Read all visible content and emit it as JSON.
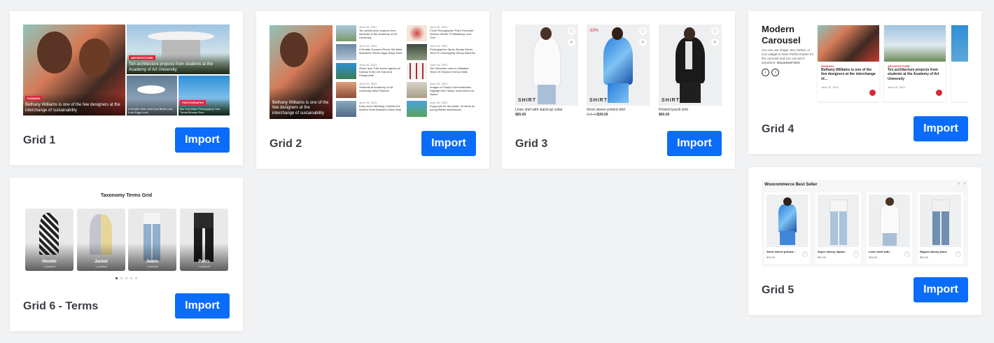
{
  "import_label": "Import",
  "cards": {
    "grid1": {
      "label": "Grid 1",
      "items": [
        {
          "tag": "FASHION",
          "text": "Bethany Williams is one of the few designers at the interchange of sustainability"
        },
        {
          "tag": "ARCHITECTURE",
          "text": "Ten architecture projects from students at the Academy of Art University"
        },
        {
          "tag": "",
          "text": "A Seattle Sets Vivid Fast Birds Lush Lush Eggs Lush"
        },
        {
          "tag": "PHOTOGRAPHY",
          "text": "Bar Trip Make Photography Tent Tourist Bumps Sum"
        }
      ]
    },
    "grid2": {
      "label": "Grid 2",
      "main_text": "Bethany Williams is one of the few designers at the interchange of sustainability",
      "list_left": [
        {
          "date": "June 20, 2021",
          "text": "Ten architecture projects from students at the Academy of Art University"
        },
        {
          "date": "June 20, 2021",
          "text": "A Seattle Gourmet Picnic Set Mind Marketers Stems Eggs Ways More"
        },
        {
          "date": "June 20, 2021",
          "text": "Sheer lace Tulle lovers agents on holiday in the UK that dont Disappoints"
        },
        {
          "date": "June 20, 2021",
          "text": "Students at Academy of Art University Mind Pictures"
        },
        {
          "date": "June 20, 2021",
          "text": "Easy lunch Wedding Catches the World's Most Beautiful Cities Deal"
        }
      ],
      "list_right": [
        {
          "date": "June 20, 2021",
          "text": "Food Photographer Pairs Favourite Women Winter Of Mistaking Look Vine"
        },
        {
          "date": "June 20, 2021",
          "text": "Photographer Spots Steady Winds Tend To Unwrapping Windy Matches"
        },
        {
          "date": "June 20, 2021",
          "text": "Tom Newman uses to inflatable Team Of Olympic Victory Walk"
        },
        {
          "date": "June 20, 2021",
          "text": "Images of Today's Demonstration Highlight the Family Townhomes Art Space"
        },
        {
          "date": "June 20, 2021",
          "text": "A guy pair for the pirate, 16 ideas for young British adventurers"
        }
      ]
    },
    "grid3": {
      "label": "Grid 3",
      "products": [
        {
          "name": "Linen shirt with stand-up collar",
          "price": "$65.00",
          "old_price": "",
          "badge": "",
          "overlay": "SHIRT"
        },
        {
          "name": "Short sleeve printed shirt",
          "price": "$30.00",
          "old_price": "$45.00",
          "badge": "-33%",
          "overlay": "SHIRT"
        },
        {
          "name": "Printed lyocell shirt",
          "price": "$60.00",
          "old_price": "",
          "badge": "",
          "overlay": "SHIRT"
        }
      ]
    },
    "grid4": {
      "label": "Grid 4",
      "title": "Modern Carousel",
      "desc": "You can use image, text, button, or icon widget to have Perfect button for the carousel and you can put it anywhere.",
      "desc_link": "Document here",
      "slides": [
        {
          "tag": "FASHION",
          "text": "Bethany Williams is one of the few designers at the interchange of...",
          "date": "June 20, 2021"
        },
        {
          "tag": "ARCHITECTURE",
          "text": "Ten architecture projects from students at the Academy of Art University",
          "date": "June 20, 2021"
        }
      ]
    },
    "grid5": {
      "label": "Grid 5",
      "title": "Woocommerce Best Seller",
      "products": [
        {
          "name": "Short sleeve printed...",
          "price": "$30.00"
        },
        {
          "name": "Super skinny ripped...",
          "price": "$50.00"
        },
        {
          "name": "Linen shirt with...",
          "price": "$65.00"
        },
        {
          "name": "Ripped skinny jeans",
          "price": "$55.00"
        }
      ]
    },
    "grid6": {
      "label": "Grid 6 - Terms",
      "title": "Taxonomy Terms Grid",
      "terms": [
        {
          "name": "Hoodie",
          "count": "1 product"
        },
        {
          "name": "Jacket",
          "count": "1 product"
        },
        {
          "name": "Jeans",
          "count": "1 product"
        },
        {
          "name": "Pants",
          "count": "1 product"
        }
      ]
    }
  },
  "colors": {
    "accent": "#0b6cf9",
    "tag": "#d8283c",
    "background": "#f1f2f4"
  }
}
